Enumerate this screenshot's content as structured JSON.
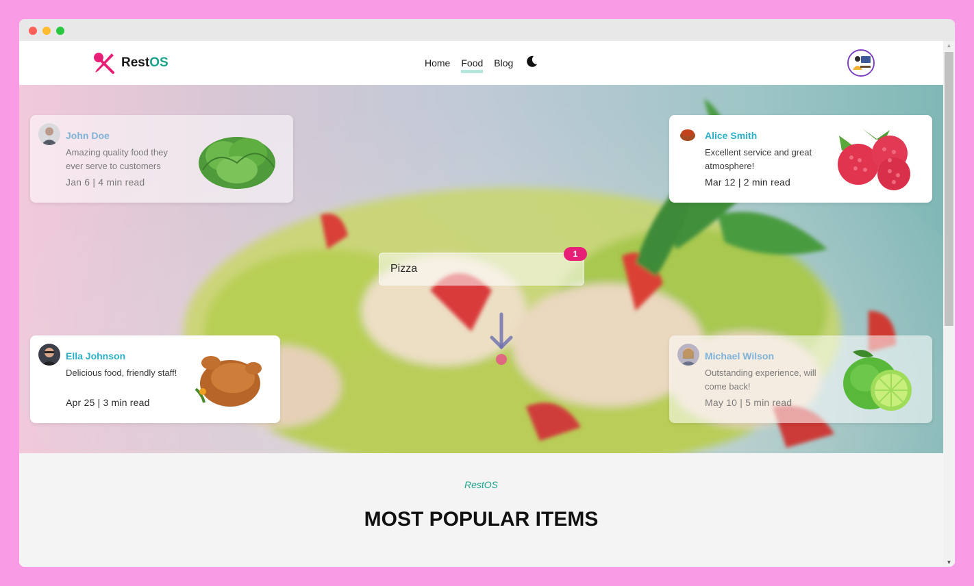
{
  "brand": {
    "name_prefix": "Rest",
    "name_suffix": "OS",
    "accent": "#1aa38a",
    "logo_color": "#e81f76"
  },
  "nav": {
    "items": [
      {
        "label": "Home",
        "active": false
      },
      {
        "label": "Food",
        "active": true
      },
      {
        "label": "Blog",
        "active": false
      }
    ],
    "theme_toggle_icon": "moon-icon"
  },
  "hero": {
    "search": {
      "value": "Pizza",
      "badge": "1"
    },
    "reviews": [
      {
        "name": "John Doe",
        "text": "Amazing quality food they ever serve to customers",
        "meta": "Jan 6 | 4 min read",
        "image": "lettuce",
        "faded": true
      },
      {
        "name": "Alice Smith",
        "text": "Excellent service and great atmosphere!",
        "meta": "Mar 12 | 2 min read",
        "image": "raspberries",
        "faded": false
      },
      {
        "name": "Ella Johnson",
        "text": "Delicious food, friendly staff!",
        "meta": "Apr 25 | 3 min read",
        "image": "roast-chicken",
        "faded": false
      },
      {
        "name": "Michael Wilson",
        "text": "Outstanding experience, will come back!",
        "meta": "May 10 | 5 min read",
        "image": "lime",
        "faded": true
      }
    ]
  },
  "section": {
    "kicker": "RestOS",
    "title": "MOST POPULAR ITEMS"
  }
}
